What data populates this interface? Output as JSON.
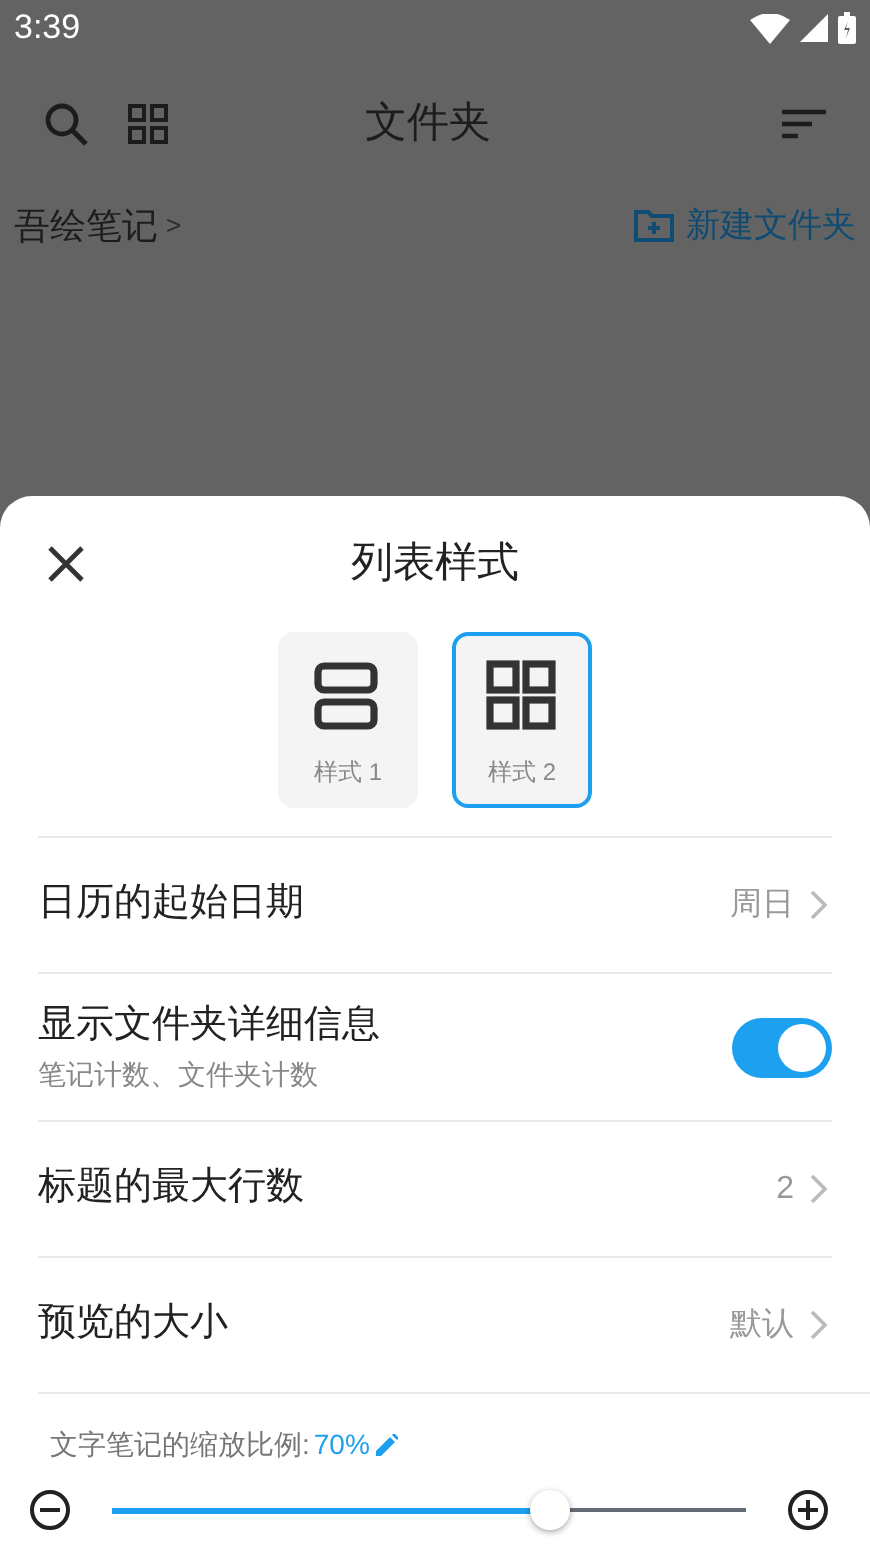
{
  "status_bar": {
    "time": "3:39"
  },
  "toolbar": {
    "title": "文件夹"
  },
  "breadcrumb": {
    "path": "吾绘笔记",
    "separator": ">",
    "action": "新建文件夹"
  },
  "sheet": {
    "title": "列表样式",
    "styles": [
      {
        "label": "样式 1",
        "kind": "list",
        "selected": false
      },
      {
        "label": "样式 2",
        "kind": "grid",
        "selected": true
      }
    ],
    "settings": [
      {
        "kind": "value",
        "label": "日历的起始日期",
        "value": "周日"
      },
      {
        "kind": "toggle",
        "label": "显示文件夹详细信息",
        "sublabel": "笔记计数、文件夹计数",
        "on": true
      },
      {
        "kind": "value",
        "label": "标题的最大行数",
        "value": "2"
      },
      {
        "kind": "value",
        "label": "预览的大小",
        "value": "默认"
      }
    ],
    "zoom": {
      "label": "文字笔记的缩放比例:",
      "value": "70%",
      "level": 0.69
    }
  }
}
